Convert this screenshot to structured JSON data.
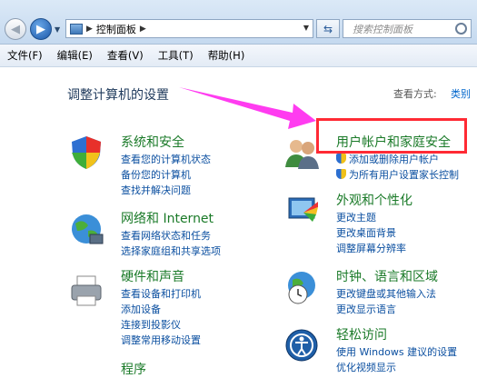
{
  "address_bar": {
    "path_item": "控制面板",
    "search_placeholder": "搜索控制面板"
  },
  "menu": [
    "文件(F)",
    "编辑(E)",
    "查看(V)",
    "工具(T)",
    "帮助(H)"
  ],
  "page": {
    "title": "调整计算机的设置",
    "view_by_label": "查看方式:",
    "view_by_value": "类别"
  },
  "categories": {
    "system_security": {
      "title": "系统和安全",
      "links": [
        "查看您的计算机状态",
        "备份您的计算机",
        "查找并解决问题"
      ]
    },
    "network": {
      "title": "网络和 Internet",
      "links": [
        "查看网络状态和任务",
        "选择家庭组和共享选项"
      ]
    },
    "hardware": {
      "title": "硬件和声音",
      "links": [
        "查看设备和打印机",
        "添加设备",
        "连接到投影仪",
        "调整常用移动设置"
      ]
    },
    "programs": {
      "title": "程序"
    },
    "user_accounts": {
      "title": "用户帐户和家庭安全",
      "links": [
        "添加或删除用户帐户",
        "为所有用户设置家长控制"
      ]
    },
    "appearance": {
      "title": "外观和个性化",
      "links": [
        "更改主题",
        "更改桌面背景",
        "调整屏幕分辨率"
      ]
    },
    "clock": {
      "title": "时钟、语言和区域",
      "links": [
        "更改键盘或其他输入法",
        "更改显示语言"
      ]
    },
    "ease": {
      "title": "轻松访问",
      "links": [
        "使用 Windows 建议的设置",
        "优化视频显示"
      ]
    }
  },
  "colors": {
    "category_title": "#1a7a28",
    "link": "#0b4fa0",
    "highlight_box": "#ff2a34",
    "annotation_arrow": "#ff3cf0"
  }
}
